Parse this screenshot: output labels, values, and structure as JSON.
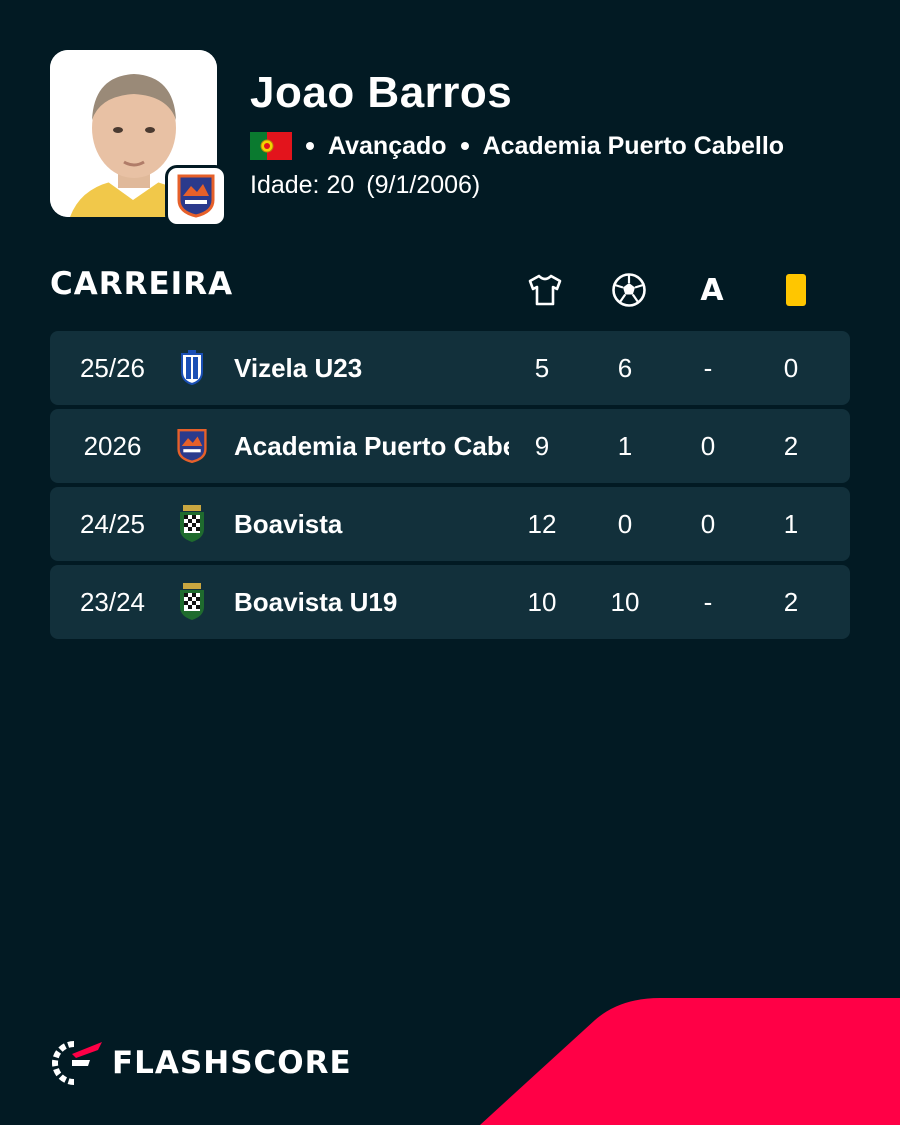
{
  "player": {
    "name": "Joao Barros",
    "position": "Avançado",
    "club": "Academia Puerto Cabello",
    "age_label": "Idade: 20",
    "birth_date": "(9/1/2006)",
    "nationality_flag": "portugal-flag"
  },
  "career": {
    "title": "CARREIRA",
    "columns": [
      {
        "icon": "shirt-icon"
      },
      {
        "icon": "ball-icon"
      },
      {
        "label": "A"
      },
      {
        "icon": "yellow-card-icon"
      }
    ],
    "rows": [
      {
        "season": "25/26",
        "team": "Vizela U23",
        "crest": "vizela-crest-icon",
        "appearances": "5",
        "goals": "6",
        "assists": "-",
        "yellow_cards": "0"
      },
      {
        "season": "2026",
        "team": "Academia Puerto Cabello",
        "crest": "academia-crest-icon",
        "appearances": "9",
        "goals": "1",
        "assists": "0",
        "yellow_cards": "2"
      },
      {
        "season": "24/25",
        "team": "Boavista",
        "crest": "boavista-crest-icon",
        "appearances": "12",
        "goals": "0",
        "assists": "0",
        "yellow_cards": "1"
      },
      {
        "season": "23/24",
        "team": "Boavista U19",
        "crest": "boavista-crest-icon",
        "appearances": "10",
        "goals": "10",
        "assists": "-",
        "yellow_cards": "2"
      }
    ]
  },
  "brand": {
    "name": "FLASHSCORE",
    "accent_color": "#ff0046",
    "background_color": "#021a23",
    "row_color": "#12303b",
    "card_color": "#ffc600"
  }
}
